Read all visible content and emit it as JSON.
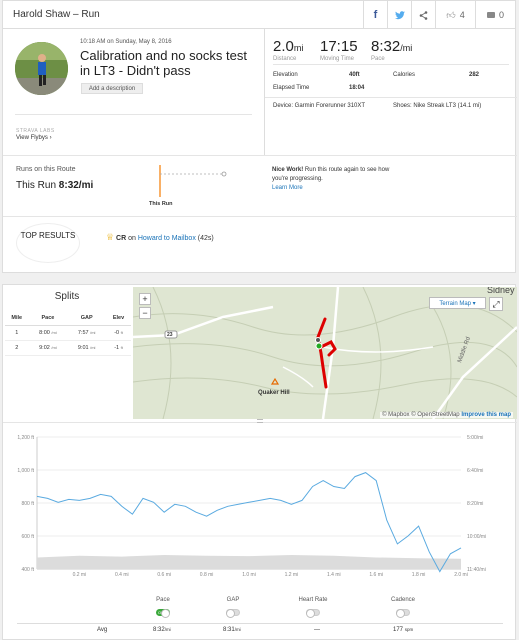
{
  "header": {
    "title": "Harold Shaw – Run",
    "kudos_count": "4",
    "comment_count": "0"
  },
  "activity": {
    "datetime": "10:18 AM on Sunday, May 8, 2016",
    "title": "Calibration and no socks test in LT3 - Didn't pass",
    "add_description": "Add a description",
    "strava_labs": "STRAVA LABS",
    "view_flybys": "View Flybys ›"
  },
  "stats": {
    "distance_value": "2.0",
    "distance_unit": "mi",
    "distance_label": "Distance",
    "moving_time_value": "17:15",
    "moving_time_label": "Moving Time",
    "pace_value": "8:32",
    "pace_unit": "/mi",
    "pace_label": "Pace",
    "elevation_label": "Elevation",
    "elevation_value": "40ft",
    "calories_label": "Calories",
    "calories_value": "282",
    "elapsed_label": "Elapsed Time",
    "elapsed_value": "18:04",
    "device": "Device: Garmin Forerunner 310XT",
    "shoes": "Shoes: Nike Streak LT3 (14.1 mi)"
  },
  "route": {
    "runs_on_route": "Runs on this Route",
    "this_run_label": "This Run",
    "this_run_pace": "8:32/mi",
    "marker_label": "This Run",
    "nice_work": "Nice Work!",
    "nice_work_text": " Run this route again to see how you're progressing.",
    "learn_more": "Learn More"
  },
  "top_results": {
    "label": "TOP RESULTS",
    "cr": "CR",
    "cr_on": " on ",
    "segment": "Howard to Mailbox",
    "time": " (42s)"
  },
  "splits": {
    "title": "Splits",
    "columns": [
      "Mile",
      "Pace",
      "GAP",
      "Elev"
    ],
    "rows": [
      {
        "mile": "1",
        "pace": "8:00",
        "pace_unit": "/mi",
        "gap": "7:57",
        "gap_unit": "/mi",
        "elev": "-0",
        "elev_unit": "ft"
      },
      {
        "mile": "2",
        "pace": "9:02",
        "pace_unit": "/mi",
        "gap": "9:01",
        "gap_unit": "/mi",
        "elev": "-1",
        "elev_unit": "ft"
      }
    ]
  },
  "map": {
    "zoom_in": "+",
    "zoom_out": "−",
    "terrain_map": "Terrain Map ▾",
    "place_sidney": "Sidney",
    "place_quaker_hill": "Quaker Hill",
    "road_middle_rd": "Middle Rd",
    "route_23": "23",
    "attribution": "© Mapbox © OpenStreetMap ",
    "improve": "Improve this map"
  },
  "chart_data": {
    "type": "line",
    "xlabel": "",
    "x_ticks": [
      "0.2 mi",
      "0.4 mi",
      "0.6 mi",
      "0.8 mi",
      "1.0 mi",
      "1.2 mi",
      "1.4 mi",
      "1.6 mi",
      "1.8 mi",
      "2.0 mi"
    ],
    "y_left_ticks": [
      "1,200 ft",
      "1,000 ft",
      "800 ft",
      "600 ft",
      "400 ft"
    ],
    "y_right_ticks": [
      "5:00/mi",
      "6:40/mi",
      "8:20/mi",
      "10:00/mi",
      "11:40/mi"
    ],
    "xlim": [
      0,
      2.0
    ],
    "ylim_left": [
      400,
      1200
    ],
    "elevation_series": {
      "x": [
        0.0,
        0.2,
        0.4,
        0.6,
        0.8,
        1.0,
        1.2,
        1.4,
        1.6,
        1.8,
        2.0
      ],
      "values": [
        470,
        480,
        475,
        485,
        480,
        478,
        485,
        480,
        470,
        465,
        462
      ]
    },
    "pace_series": {
      "unit": "min/mi (inverted)",
      "x": [
        0.0,
        0.05,
        0.1,
        0.15,
        0.2,
        0.25,
        0.3,
        0.35,
        0.4,
        0.45,
        0.5,
        0.55,
        0.6,
        0.65,
        0.7,
        0.75,
        0.8,
        0.85,
        0.9,
        0.95,
        1.0,
        1.05,
        1.1,
        1.15,
        1.2,
        1.25,
        1.3,
        1.35,
        1.4,
        1.45,
        1.5,
        1.55,
        1.6,
        1.65,
        1.7,
        1.75,
        1.8,
        1.85,
        1.9,
        1.95,
        2.0
      ],
      "values": [
        8.0,
        8.1,
        8.3,
        8.15,
        8.2,
        8.1,
        7.9,
        8.0,
        8.5,
        8.9,
        8.1,
        8.3,
        8.8,
        8.4,
        8.5,
        8.8,
        9.0,
        8.7,
        8.5,
        8.4,
        8.3,
        8.2,
        8.1,
        8.2,
        8.4,
        8.2,
        7.5,
        7.2,
        7.5,
        7.6,
        7.0,
        6.8,
        7.2,
        9.2,
        10.4,
        10.0,
        9.5,
        10.8,
        11.8,
        10.9,
        10.6
      ]
    }
  },
  "toggles": {
    "pace": "Pace",
    "pace_state": "ON",
    "gap": "GAP",
    "heart_rate": "Heart Rate",
    "cadence": "Cadence"
  },
  "avg_row": {
    "label": "Avg",
    "pace": "8:32",
    "pace_unit": "/mi",
    "gap": "8:31",
    "gap_unit": "/mi",
    "heart_rate": "—",
    "cadence": "177",
    "cadence_unit": "spm"
  },
  "colors": {
    "brand_blue": "#1a73b8",
    "route_red": "#dd0000",
    "orange_marker": "#f57c00",
    "pace_line": "#5aaae0",
    "elevation_fill": "#dcdcdc",
    "toggle_green": "#3aa83a"
  }
}
